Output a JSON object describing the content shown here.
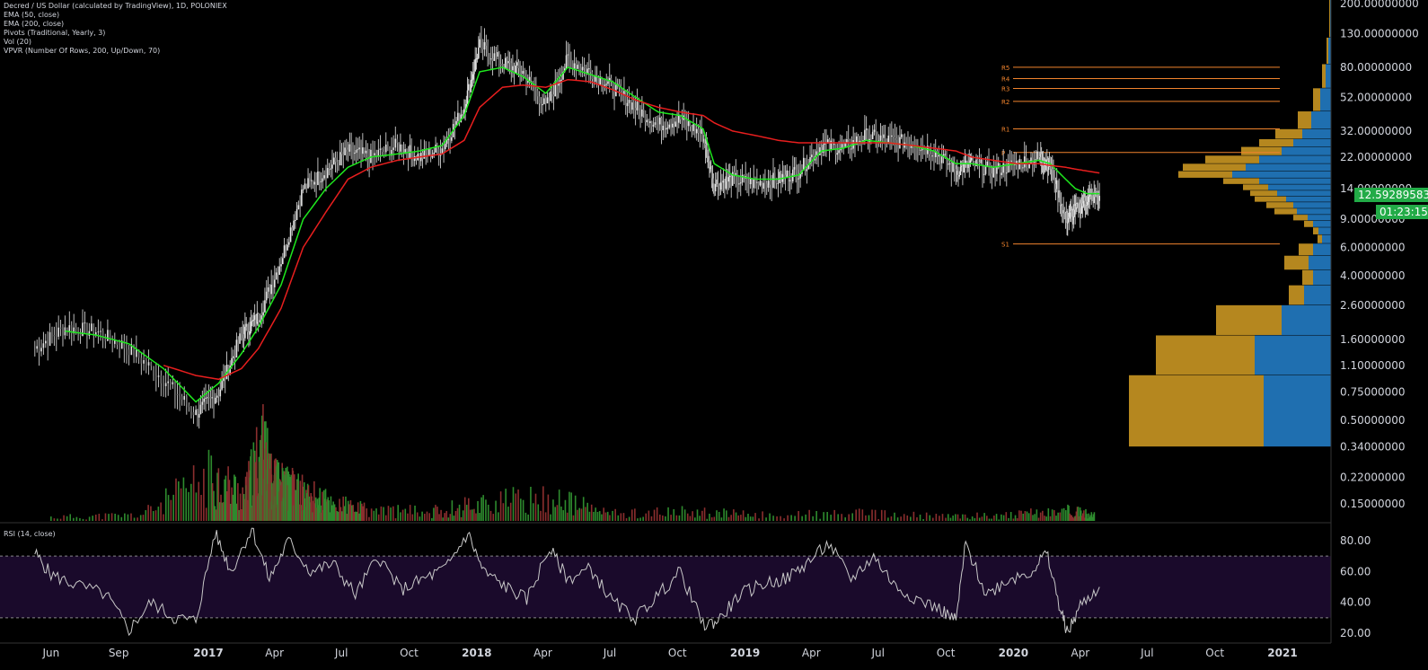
{
  "legend": {
    "title": "Decred / US Dollar (calculated by TradingView), 1D, POLONIEX",
    "lines": [
      "EMA (50, close)",
      "EMA (200, close)",
      "Pivots (Traditional, Yearly, 3)",
      "Vol (20)",
      "VPVR (Number Of Rows, 200, Up/Down, 70)"
    ]
  },
  "rsi_title": "RSI (14, close)",
  "last_price": "12.59289583",
  "countdown": "01:23:15",
  "colors": {
    "background": "#000000",
    "ema50": "#1ee81e",
    "ema200": "#e81e1e",
    "pivot": "#f0832d",
    "vpvr_up": "#1f6fb0",
    "vpvr_down": "#b5871f",
    "rsi": "#c8c8c8",
    "rsi_band": "#1a0a2b",
    "price_tag": "#22ab47"
  },
  "chart_data": [
    {
      "type": "line",
      "title": "Decred / US Dollar (calculated by TradingView), 1D, POLONIEX",
      "y_scale": "log",
      "ylim": [
        0.3,
        240
      ],
      "x_ticks": [
        "Jun",
        "Sep",
        "2017",
        "Apr",
        "Jul",
        "Oct",
        "2018",
        "Apr",
        "Jul",
        "Oct",
        "2019",
        "Apr",
        "Jul",
        "Oct",
        "2020",
        "Apr",
        "Jul",
        "Oct",
        "2021"
      ],
      "y_ticks": [
        "200.00000000",
        "130.00000000",
        "80.00000000",
        "52.00000000",
        "32.00000000",
        "22.00000000",
        "14.00000000",
        "9.00000000",
        "6.00000000",
        "4.00000000",
        "2.60000000",
        "1.60000000",
        "1.10000000",
        "0.75000000",
        "0.50000000",
        "0.34000000",
        "0.22000000",
        "0.15000000"
      ],
      "y_tick_values": [
        200,
        130,
        80,
        52,
        32,
        22,
        14,
        9,
        6,
        4,
        2.6,
        1.6,
        1.1,
        0.75,
        0.5,
        0.34,
        0.22,
        0.15
      ],
      "x_dates": [
        "2016-05-10",
        "2016-06-20",
        "2016-08-01",
        "2016-09-15",
        "2016-11-01",
        "2016-12-15",
        "2017-01-15",
        "2017-02-15",
        "2017-03-10",
        "2017-04-10",
        "2017-05-10",
        "2017-06-10",
        "2017-07-10",
        "2017-08-10",
        "2017-09-15",
        "2017-10-15",
        "2017-11-15",
        "2017-12-15",
        "2018-01-05",
        "2018-02-05",
        "2018-03-05",
        "2018-04-05",
        "2018-05-05",
        "2018-06-05",
        "2018-07-05",
        "2018-08-05",
        "2018-09-05",
        "2018-10-05",
        "2018-11-05",
        "2018-11-20",
        "2018-12-15",
        "2019-01-15",
        "2019-02-15",
        "2019-03-15",
        "2019-04-15",
        "2019-05-15",
        "2019-06-15",
        "2019-07-15",
        "2019-08-15",
        "2019-09-15",
        "2019-10-15",
        "2019-11-05",
        "2019-12-05",
        "2020-01-05",
        "2020-02-05",
        "2020-02-20",
        "2020-03-12",
        "2020-03-25",
        "2020-04-10",
        "2020-04-27"
      ],
      "series": [
        {
          "values": [
            1.4,
            1.9,
            1.8,
            1.4,
            0.9,
            0.55,
            0.75,
            1.7,
            2.2,
            5,
            14,
            18,
            24,
            22,
            26,
            22,
            25,
            45,
            110,
            85,
            75,
            45,
            90,
            75,
            60,
            45,
            35,
            38,
            30,
            15,
            16,
            15,
            16,
            18,
            26,
            25,
            30,
            28,
            27,
            24,
            18,
            20,
            18,
            20,
            22,
            20,
            9,
            10,
            12,
            12.6
          ]
        },
        {
          "name": "EMA (50, close)",
          "values": [
            null,
            1.8,
            1.7,
            1.5,
            1.05,
            0.65,
            0.85,
            1.3,
            1.9,
            3.5,
            9,
            14,
            19,
            22,
            23,
            24,
            26,
            40,
            75,
            80,
            70,
            55,
            80,
            72,
            65,
            52,
            42,
            40,
            33,
            20,
            17,
            16,
            16,
            17,
            24,
            25,
            28,
            27,
            26,
            24,
            20,
            20,
            19,
            20,
            21,
            20,
            16,
            14,
            13,
            13
          ]
        },
        {
          "name": "EMA (200, close)",
          "values": [
            null,
            null,
            null,
            null,
            1.1,
            0.95,
            0.9,
            1.05,
            1.4,
            2.5,
            6,
            10,
            16,
            19,
            21,
            22,
            23,
            28,
            45,
            60,
            62,
            60,
            67,
            65,
            58,
            50,
            45,
            42,
            40,
            36,
            32,
            30,
            28,
            27,
            27,
            27,
            27,
            27,
            26,
            25,
            24,
            22,
            21,
            20,
            20,
            19.5,
            19,
            18.5,
            18,
            17.5
          ]
        }
      ]
    },
    {
      "type": "bar",
      "title": "Vol (20)",
      "x_dates": [
        "2016-06-01",
        "2016-10-01",
        "2017-01-05",
        "2017-02-20",
        "2017-03-15",
        "2017-03-28",
        "2017-04-05",
        "2017-04-20",
        "2017-05-15",
        "2017-06-15",
        "2017-08-01",
        "2017-11-01",
        "2018-01-10",
        "2018-04-15",
        "2018-07-01",
        "2018-10-15",
        "2019-01-15",
        "2019-06-01",
        "2019-10-01",
        "2020-01-01",
        "2020-03-15",
        "2020-04-20"
      ],
      "values": [
        0.05,
        0.08,
        0.6,
        0.35,
        1.0,
        0.55,
        0.5,
        0.45,
        0.35,
        0.25,
        0.15,
        0.12,
        0.25,
        0.3,
        0.1,
        0.12,
        0.08,
        0.1,
        0.06,
        0.08,
        0.14,
        0.08
      ]
    },
    {
      "type": "bar",
      "title": "VPVR (Number Of Rows, 200, Up/Down, 70)",
      "price_levels": [
        150,
        100,
        70,
        50,
        36,
        30,
        27,
        24,
        21,
        19,
        17,
        15.5,
        14.2,
        13,
        12,
        11,
        10,
        9.2,
        8.4,
        7.6,
        6.8,
        5.9,
        4.8,
        3.9,
        3.1,
        2.2,
        1.3,
        0.7
      ],
      "series": [
        {
          "name": "Up",
          "values": [
            1,
            3,
            6,
            12,
            22,
            32,
            42,
            55,
            80,
            95,
            110,
            80,
            70,
            60,
            50,
            42,
            38,
            26,
            20,
            14,
            10,
            20,
            25,
            20,
            30,
            55,
            85,
            75
          ]
        },
        {
          "name": "Down",
          "values": [
            1,
            2,
            4,
            8,
            15,
            30,
            38,
            45,
            60,
            70,
            60,
            40,
            28,
            30,
            35,
            30,
            25,
            16,
            10,
            6,
            5,
            16,
            27,
            12,
            17,
            73,
            110,
            150
          ]
        }
      ],
      "max_width_units": 350
    },
    {
      "type": "line",
      "title": "Pivots (Traditional, Yearly, 3)",
      "levels": [
        {
          "label": "R5",
          "value": 80
        },
        {
          "label": "R4",
          "value": 68
        },
        {
          "label": "R3",
          "value": 59
        },
        {
          "label": "R2",
          "value": 49
        },
        {
          "label": "R1",
          "value": 33
        },
        {
          "label": "P",
          "value": 23.5
        },
        {
          "label": "S1",
          "value": 6.3
        }
      ]
    },
    {
      "type": "line",
      "title": "RSI (14, close)",
      "ylim": [
        15,
        92
      ],
      "y_ticks": [
        "80.00",
        "60.00",
        "40.00",
        "20.00"
      ],
      "y_tick_values": [
        80,
        60,
        40,
        20
      ],
      "bands": [
        30,
        70
      ],
      "x_dates": [
        "2016-05-10",
        "2016-06-01",
        "2016-07-01",
        "2016-08-15",
        "2016-09-15",
        "2016-10-15",
        "2016-11-15",
        "2016-12-15",
        "2017-01-10",
        "2017-02-01",
        "2017-03-01",
        "2017-03-25",
        "2017-04-20",
        "2017-05-20",
        "2017-06-20",
        "2017-07-20",
        "2017-08-20",
        "2017-09-20",
        "2017-10-20",
        "2017-11-20",
        "2017-12-20",
        "2018-01-10",
        "2018-02-10",
        "2018-03-10",
        "2018-04-10",
        "2018-05-05",
        "2018-06-05",
        "2018-07-05",
        "2018-08-05",
        "2018-09-05",
        "2018-10-05",
        "2018-11-05",
        "2018-11-25",
        "2018-12-25",
        "2019-01-25",
        "2019-02-25",
        "2019-03-25",
        "2019-04-25",
        "2019-05-25",
        "2019-06-25",
        "2019-07-25",
        "2019-08-25",
        "2019-09-25",
        "2019-10-15",
        "2019-10-28",
        "2019-11-25",
        "2019-12-25",
        "2020-01-25",
        "2020-02-15",
        "2020-03-05",
        "2020-03-15",
        "2020-04-01",
        "2020-04-27"
      ],
      "values": [
        72,
        58,
        52,
        45,
        22,
        40,
        30,
        28,
        85,
        60,
        88,
        55,
        80,
        60,
        65,
        45,
        70,
        48,
        55,
        62,
        85,
        60,
        50,
        42,
        75,
        55,
        62,
        40,
        30,
        45,
        60,
        25,
        28,
        45,
        52,
        55,
        65,
        78,
        55,
        70,
        50,
        42,
        35,
        28,
        78,
        45,
        55,
        60,
        72,
        35,
        20,
        38,
        50
      ]
    }
  ]
}
